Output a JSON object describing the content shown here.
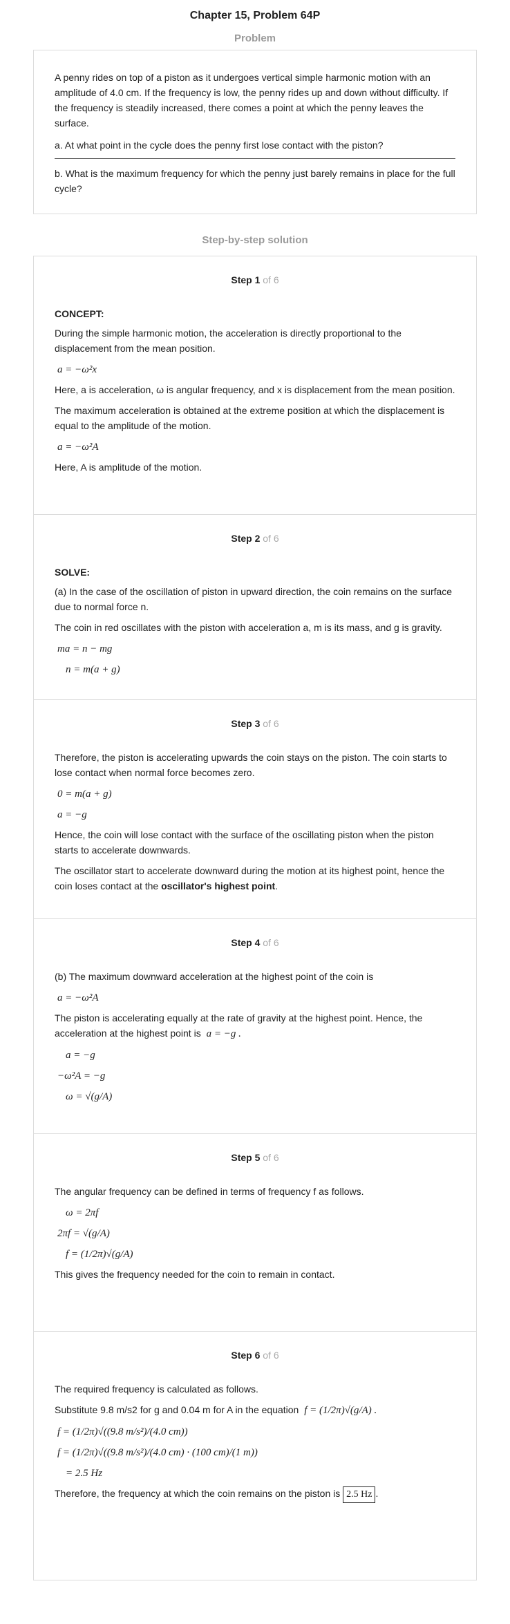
{
  "page": {
    "title": "Chapter 15, Problem 64P",
    "problem_heading": "Problem",
    "solution_heading": "Step-by-step solution"
  },
  "problem": {
    "text": "A penny rides on top of a piston as it undergoes vertical simple harmonic motion with an amplitude of 4.0 cm. If the frequency is low, the penny rides up and down without difficulty. If the frequency is steadily increased, there comes a point at which the penny leaves the surface.",
    "part_a": "a. At what point in the cycle does the penny first lose contact with the piston?",
    "part_b": "b. What is the maximum frequency for which the penny just barely remains in place for the full cycle?"
  },
  "steps": [
    {
      "label": "Step 1",
      "of": "of 6",
      "concept": "CONCEPT:",
      "p1": "During the simple harmonic motion, the acceleration is directly proportional to the displacement from the mean position.",
      "eq1": "a = −ω²x",
      "p2": "Here,  a  is acceleration,  ω  is angular frequency, and  x  is displacement from the mean position.",
      "p3": "The maximum acceleration is obtained at the extreme position at which the displacement is equal to the amplitude of the motion.",
      "eq2": "a = −ω²A",
      "p4": "Here,  A  is amplitude of the motion."
    },
    {
      "label": "Step 2",
      "of": "of 6",
      "solve": "SOLVE:",
      "p1": "(a) In the case of the oscillation of piston in upward direction, the coin remains on the surface due to normal force n.",
      "p2": "The coin in red oscillates with the piston with acceleration a, m is its mass, and g is gravity.",
      "eq1": "ma = n − mg",
      "eq2": "n = m(a + g)"
    },
    {
      "label": "Step 3",
      "of": "of 6",
      "p1": "Therefore, the piston is accelerating upwards the coin stays on the piston. The coin starts to lose contact when normal force becomes zero.",
      "eq1": "0 = m(a + g)",
      "eq2": "a = −g",
      "p2": "Hence, the coin will lose contact with the surface of the oscillating piston when the piston starts to accelerate downwards.",
      "p3": "The oscillator start to accelerate downward during the motion at its highest point, hence the coin loses contact at the",
      "p3_bold": "oscillator's highest point",
      "p3_end": "."
    },
    {
      "label": "Step 4",
      "of": "of 6",
      "p1": "(b) The maximum downward acceleration at the highest point of the coin is",
      "eq1": "a = −ω²A",
      "p2": "The piston is accelerating equally at the rate of gravity at the highest point. Hence, the acceleration at the highest point is",
      "p2_eq": "a = −g .",
      "eq2": "a = −g",
      "eq3": "−ω²A = −g",
      "eq4": "ω = √(g/A)"
    },
    {
      "label": "Step 5",
      "of": "of 6",
      "p1": "The angular frequency can be defined in terms of frequency f as follows.",
      "eq1": "ω = 2πf",
      "eq2": "2πf = √(g/A)",
      "eq3": "f = (1/2π)√(g/A)",
      "p2": "This gives the frequency needed for the coin to remain in contact."
    },
    {
      "label": "Step 6",
      "of": "of 6",
      "p1": "The required frequency is calculated as follows.",
      "p2": "Substitute 9.8 m/s2 for g and 0.04 m for A in the equation",
      "p2_eq": "f = (1/2π)√(g/A) .",
      "eq1": "f = (1/2π)√((9.8 m/s²)/(4.0 cm))",
      "eq2": "f = (1/2π)√((9.8 m/s²)/(4.0 cm) · (100 cm)/(1 m))",
      "eq3": "= 2.5 Hz",
      "p3": "Therefore, the frequency at which the coin remains on the piston is",
      "answer": "2.5 Hz",
      "p3_end": "."
    }
  ]
}
